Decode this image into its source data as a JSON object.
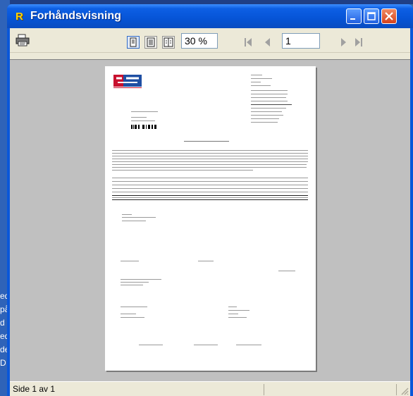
{
  "window": {
    "title": "Forhåndsvisning",
    "app_icon_letter": "R"
  },
  "toolbar": {
    "print_icon": "printer-icon",
    "zoom_value": "30 %",
    "page_value": "1",
    "view_buttons": [
      "single-page-icon",
      "full-width-icon",
      "two-page-icon"
    ],
    "nav_icons": [
      "first-page-icon",
      "previous-page-icon",
      "next-page-icon",
      "last-page-icon"
    ]
  },
  "status": {
    "page_info": "Side 1 av 1"
  },
  "background_app": {
    "text_fragments": [
      "ed å",
      "på",
      "d",
      "ed",
      "de",
      "D"
    ]
  },
  "colors": {
    "titlebar": "#0654d6",
    "client": "#ece9d8",
    "preview_bg": "#c0c0c0",
    "close_button": "#d6421c"
  }
}
